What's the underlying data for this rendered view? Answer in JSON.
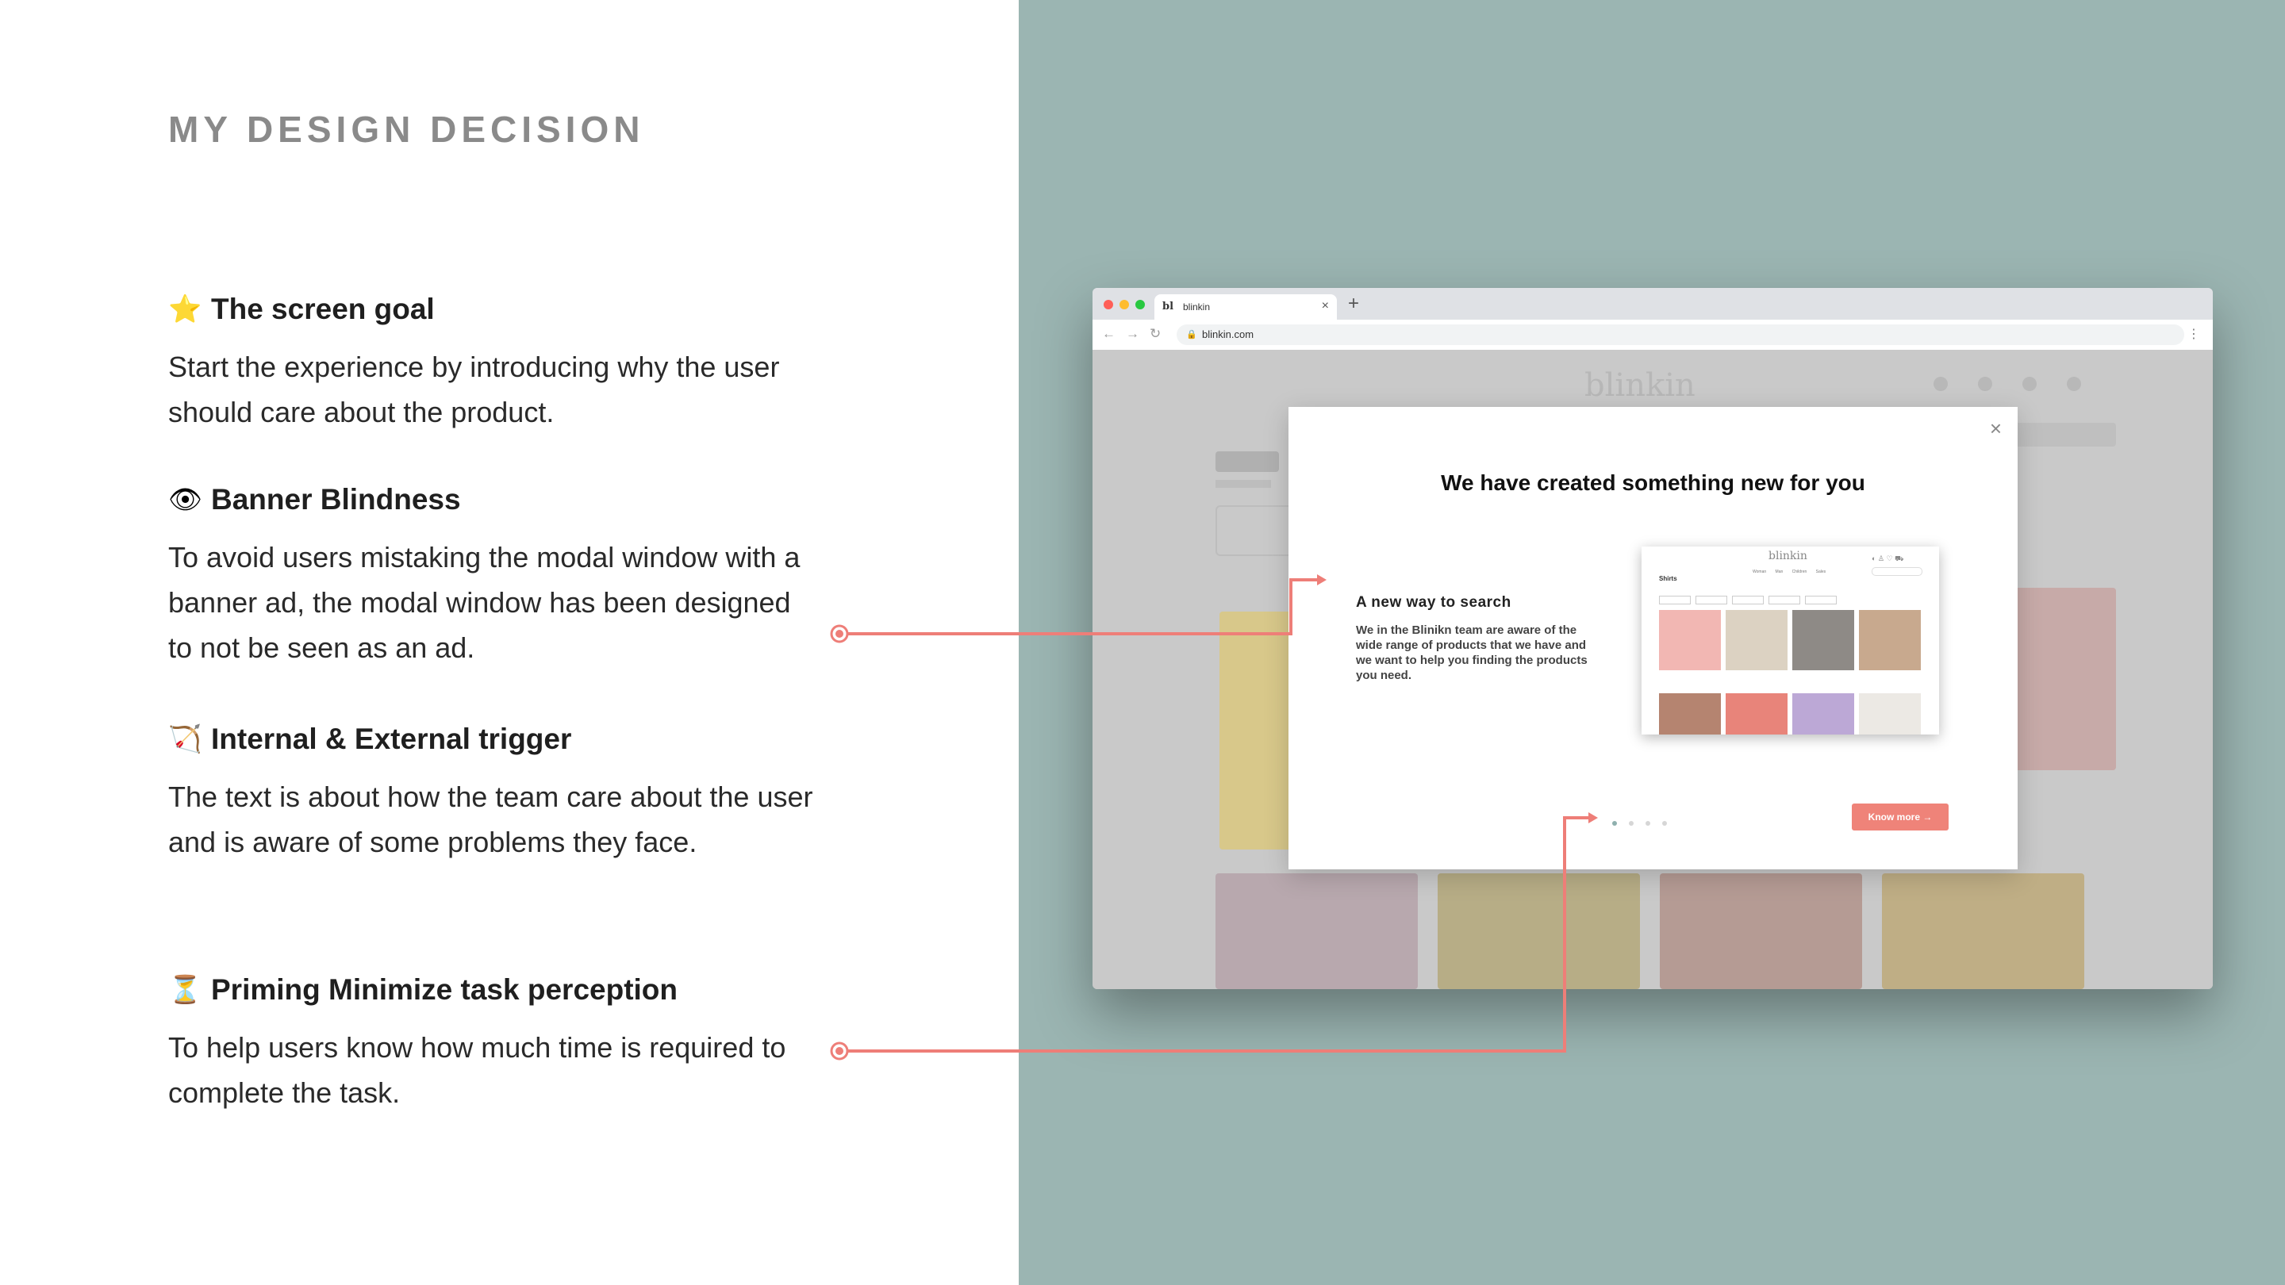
{
  "page": {
    "title": "MY DESIGN DECISION"
  },
  "sections": [
    {
      "icon": "star-icon",
      "glyph": "⭐",
      "title": "The screen goal",
      "body": "Start the experience by introducing why the user should care about the product."
    },
    {
      "icon": "eye-icon",
      "glyph": "👁",
      "title": "Banner Blindness",
      "body": "To avoid users mistaking the modal window with a banner ad, the modal window has been designed to not be seen as an ad."
    },
    {
      "icon": "bow-and-arrow-icon",
      "glyph": "🏹",
      "title": "Internal & External trigger",
      "body": "The text is about how the team care about the user and is aware of some problems they face."
    },
    {
      "icon": "hourglass-icon",
      "glyph": "⏳",
      "title": "Priming Minimize task perception",
      "body": "To help users know how much time is required to complete the task."
    }
  ],
  "browser": {
    "tab_logo": "bl",
    "tab_label": "blinkin",
    "url": "blinkin.com"
  },
  "site": {
    "logo": "blinkin"
  },
  "modal": {
    "title": "We have created something new for you",
    "subtitle": "A new way to search",
    "text": "We in the Blinikn team are aware of the wide range of products that we have and we want to help you finding the products you need.",
    "button": "Know more",
    "pages": 4,
    "active_page": 1,
    "preview": {
      "logo": "blinkin",
      "heading": "Shirts",
      "nav": "Woman Man Children Sales"
    }
  },
  "colors": {
    "right_panel": "#9bb5b2",
    "accent": "#ef8379",
    "connector": "#ee7e78"
  }
}
